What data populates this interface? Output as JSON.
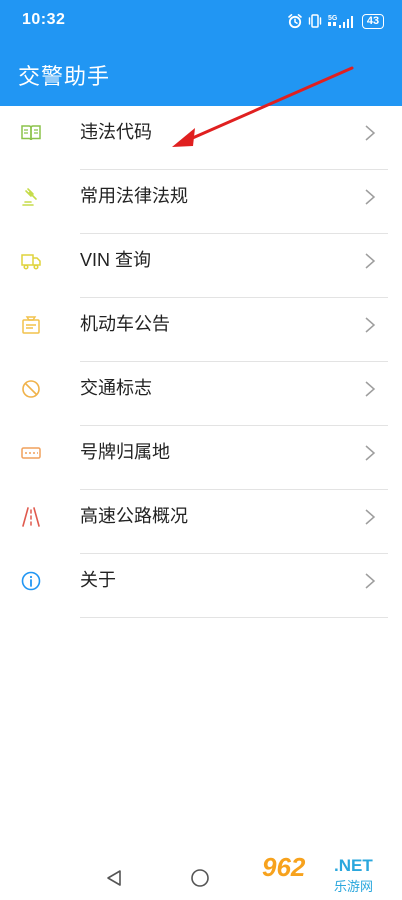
{
  "status_bar": {
    "time": "10:32",
    "battery": "43",
    "network": "5G"
  },
  "app_bar": {
    "title": "交警助手"
  },
  "menu": {
    "items": [
      {
        "label": "违法代码",
        "icon": "book-icon",
        "color": "#8bc34a"
      },
      {
        "label": "常用法律法规",
        "icon": "gavel-icon",
        "color": "#c6dc4a"
      },
      {
        "label": "VIN 查询",
        "icon": "truck-icon",
        "color": "#dfd33c"
      },
      {
        "label": "机动车公告",
        "icon": "notice-icon",
        "color": "#f2c24b"
      },
      {
        "label": "交通标志",
        "icon": "prohibited-icon",
        "color": "#f0b24a"
      },
      {
        "label": "号牌归属地",
        "icon": "license-plate-icon",
        "color": "#f0a15c"
      },
      {
        "label": "高速公路概况",
        "icon": "highway-icon",
        "color": "#e05a4e"
      },
      {
        "label": "关于",
        "icon": "info-icon",
        "color": "#2196f3"
      }
    ]
  },
  "watermark": {
    "number": "962",
    "suffix": ".NET",
    "site": "乐游网"
  },
  "colors": {
    "primary": "#2196f3",
    "annotation_arrow": "#e02020"
  }
}
